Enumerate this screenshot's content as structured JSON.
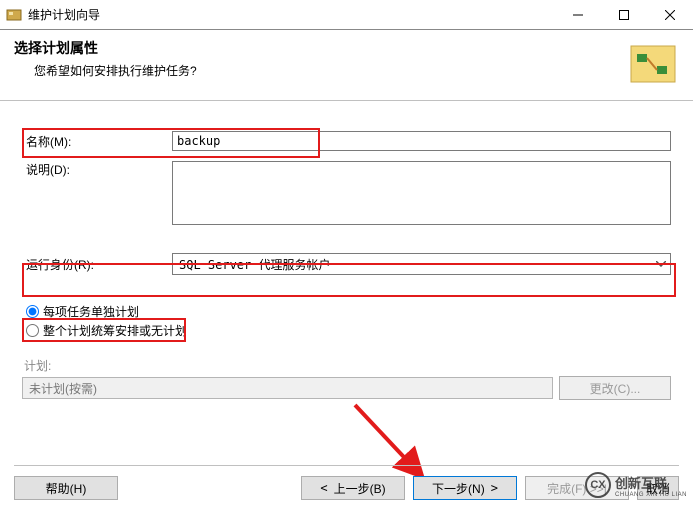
{
  "window": {
    "title": "维护计划向导"
  },
  "header": {
    "title": "选择计划属性",
    "subtitle": "您希望如何安排执行维护任务?"
  },
  "form": {
    "name_label": "名称(M):",
    "name_value": "backup",
    "desc_label": "说明(D):",
    "desc_value": "",
    "runas_label": "运行身份(R):",
    "runas_value": "SQL Server 代理服务帐户"
  },
  "scheduling": {
    "opt_separate": "每项任务单独计划",
    "opt_single": "整个计划统筹安排或无计划",
    "sched_label": "计划:",
    "sched_value": "未计划(按需)",
    "change_btn": "更改(C)..."
  },
  "footer": {
    "help": "帮助(H)",
    "back": "上一步(B)",
    "next": "下一步(N)",
    "finish": "完成(F) >>|",
    "cancel": "取消"
  },
  "watermark": {
    "text": "创新互联",
    "sub": "CHUANG XIN HU LIAN",
    "icon": "CX"
  }
}
